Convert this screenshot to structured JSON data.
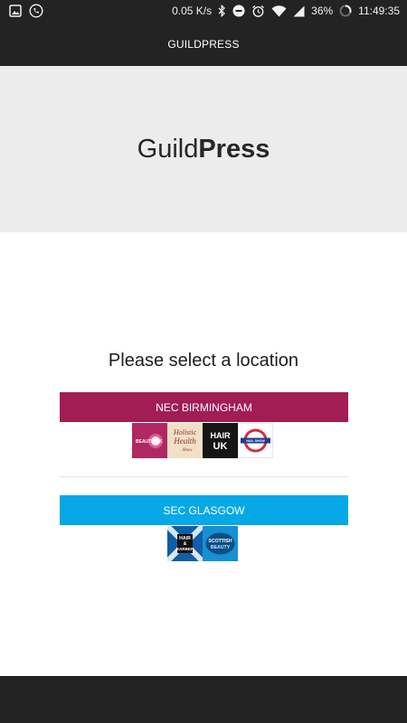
{
  "status": {
    "speed": "0.05 K/s",
    "battery": "36%",
    "time": "11:49:35"
  },
  "app_bar": {
    "title": "GUILDPRESS"
  },
  "hero": {
    "brand_light": "Guild",
    "brand_bold": "Press"
  },
  "prompt": "Please select a location",
  "locations": [
    {
      "label": "NEC BIRMINGHAM",
      "color": "#a11d54",
      "logos": [
        {
          "name": "beauty-uk-logo",
          "text": "BEAUTY UK"
        },
        {
          "name": "holistic-health-show-logo",
          "text_lines": [
            "Holistic",
            "Health",
            "Show"
          ]
        },
        {
          "name": "hair-uk-logo",
          "text_lines": [
            "HAIR",
            "UK"
          ]
        },
        {
          "name": "nail-show-logo",
          "text": "NAIL SHOW"
        }
      ]
    },
    {
      "label": "SEC GLASGOW",
      "color": "#07a8e6",
      "logos": [
        {
          "name": "hair-barber-logo",
          "text_lines": [
            "HAIR",
            "&",
            "BARBER"
          ]
        },
        {
          "name": "scottish-beauty-logo",
          "text_lines": [
            "SCOTTISH",
            "BEAUTY"
          ]
        }
      ]
    }
  ],
  "colors": {
    "bar": "#232323",
    "hero_bg": "#ececec"
  }
}
